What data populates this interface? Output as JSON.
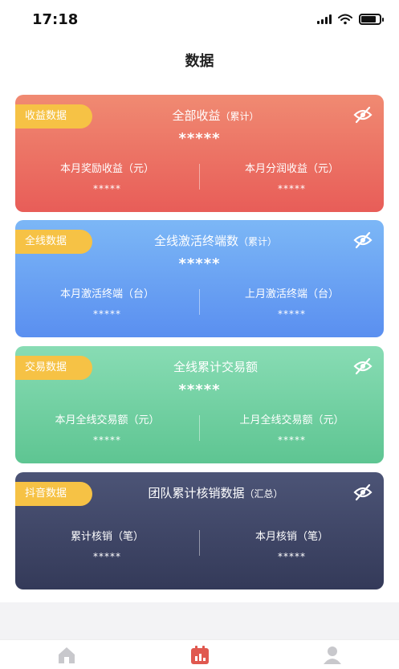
{
  "status_bar": {
    "time": "17:18"
  },
  "page": {
    "title": "数据"
  },
  "cards": [
    {
      "tag": "收益数据",
      "title": "全部收益",
      "title_suffix": "（累计）",
      "total": "*****",
      "left_label": "本月奖励收益（元）",
      "left_value": "*****",
      "right_label": "本月分润收益（元）",
      "right_value": "*****"
    },
    {
      "tag": "全线数据",
      "title": "全线激活终端数",
      "title_suffix": "（累计）",
      "total": "*****",
      "left_label": "本月激活终端（台）",
      "left_value": "*****",
      "right_label": "上月激活终端（台）",
      "right_value": "*****"
    },
    {
      "tag": "交易数据",
      "title": "全线累计交易额",
      "title_suffix": "",
      "total": "*****",
      "left_label": "本月全线交易额（元）",
      "left_value": "*****",
      "right_label": "上月全线交易额（元）",
      "right_value": "*****"
    },
    {
      "tag": "抖音数据",
      "title": "团队累计核销数据",
      "title_suffix": "（汇总）",
      "total": "",
      "left_label": "累计核销（笔）",
      "left_value": "*****",
      "right_label": "本月核销（笔）",
      "right_value": "*****"
    }
  ],
  "tabbar": {
    "items": [
      {
        "label": "首页",
        "icon": "home-icon"
      },
      {
        "label": "数据",
        "icon": "calendar-data-icon"
      },
      {
        "label": "我的",
        "icon": "user-icon"
      }
    ]
  }
}
